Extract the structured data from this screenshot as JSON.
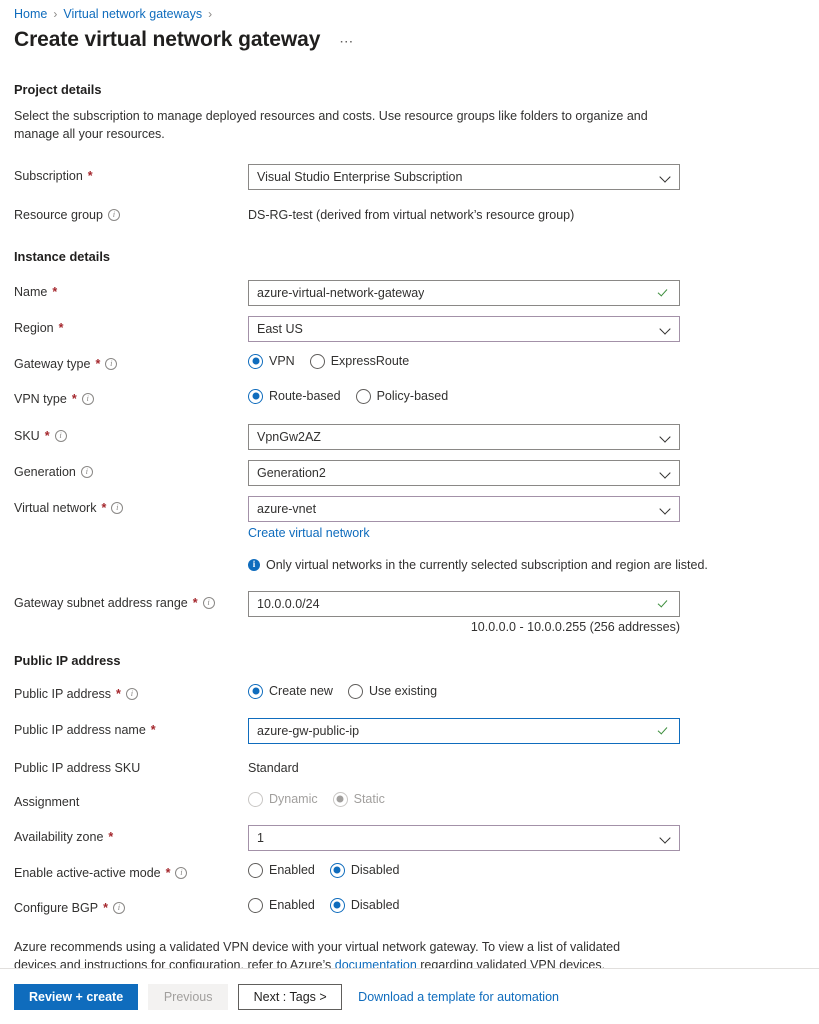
{
  "breadcrumb": {
    "items": [
      {
        "label": "Home"
      },
      {
        "label": "Virtual network gateways"
      }
    ],
    "separator": "›"
  },
  "header": {
    "title": "Create virtual network gateway",
    "more_label": "⋯"
  },
  "project_details": {
    "heading": "Project details",
    "description": "Select the subscription to manage deployed resources and costs. Use resource groups like folders to organize and manage all your resources.",
    "subscription": {
      "label": "Subscription",
      "required": "*",
      "value": "Visual Studio Enterprise Subscription"
    },
    "resource_group": {
      "label": "Resource group",
      "info_icon": "info-outline-icon",
      "value": "DS-RG-test (derived from virtual network’s resource group)"
    }
  },
  "instance_details": {
    "heading": "Instance details",
    "name": {
      "label": "Name",
      "required": "*",
      "value": "azure-virtual-network-gateway",
      "status_icon": "checkmark-icon"
    },
    "region": {
      "label": "Region",
      "required": "*",
      "value": "East US"
    },
    "gateway_type": {
      "label": "Gateway type",
      "required": "*",
      "info_icon": "info-outline-icon",
      "options": [
        {
          "label": "VPN",
          "selected": true
        },
        {
          "label": "ExpressRoute",
          "selected": false
        }
      ]
    },
    "vpn_type": {
      "label": "VPN type",
      "required": "*",
      "info_icon": "info-outline-icon",
      "options": [
        {
          "label": "Route-based",
          "selected": true
        },
        {
          "label": "Policy-based",
          "selected": false
        }
      ]
    },
    "sku": {
      "label": "SKU",
      "required": "*",
      "info_icon": "info-outline-icon",
      "value": "VpnGw2AZ"
    },
    "generation": {
      "label": "Generation",
      "info_icon": "info-outline-icon",
      "value": "Generation2"
    },
    "virtual_network": {
      "label": "Virtual network",
      "required": "*",
      "info_icon": "info-outline-icon",
      "value": "azure-vnet",
      "create_link": "Create virtual network",
      "notice": "Only virtual networks in the currently selected subscription and region are listed."
    },
    "gateway_subnet": {
      "label": "Gateway subnet address range",
      "required": "*",
      "info_icon": "info-outline-icon",
      "value": "10.0.0.0/24",
      "status_icon": "checkmark-icon",
      "helper": "10.0.0.0 - 10.0.0.255 (256 addresses)"
    }
  },
  "public_ip": {
    "heading": "Public IP address",
    "public_ip_address": {
      "label": "Public IP address",
      "required": "*",
      "info_icon": "info-outline-icon",
      "options": [
        {
          "label": "Create new",
          "selected": true
        },
        {
          "label": "Use existing",
          "selected": false
        }
      ]
    },
    "public_ip_name": {
      "label": "Public IP address name",
      "required": "*",
      "value": "azure-gw-public-ip",
      "status_icon": "checkmark-icon"
    },
    "public_ip_sku": {
      "label": "Public IP address SKU",
      "value": "Standard"
    },
    "assignment": {
      "label": "Assignment",
      "disabled": true,
      "options": [
        {
          "label": "Dynamic",
          "selected": false
        },
        {
          "label": "Static",
          "selected": true
        }
      ]
    },
    "availability_zone": {
      "label": "Availability zone",
      "required": "*",
      "value": "1"
    },
    "active_active": {
      "label": "Enable active-active mode",
      "required": "*",
      "info_icon": "info-outline-icon",
      "options": [
        {
          "label": "Enabled",
          "selected": false
        },
        {
          "label": "Disabled",
          "selected": true
        }
      ]
    },
    "configure_bgp": {
      "label": "Configure BGP",
      "required": "*",
      "info_icon": "info-outline-icon",
      "options": [
        {
          "label": "Enabled",
          "selected": false
        },
        {
          "label": "Disabled",
          "selected": true
        }
      ]
    }
  },
  "footer_note": {
    "text_before": "Azure recommends using a validated VPN device with your virtual network gateway. To view a list of validated devices and instructions for configuration, refer to Azure’s ",
    "link": "documentation",
    "text_after": " regarding validated VPN devices."
  },
  "footer": {
    "review_create": "Review + create",
    "previous": "Previous",
    "next": "Next : Tags >",
    "download_template": "Download a template for automation"
  },
  "colors": {
    "accent": "#0f6cbd",
    "required": "#a4262c",
    "success": "#3f8f3f",
    "border": "#8a8886",
    "mauve_border": "#a391a8"
  }
}
